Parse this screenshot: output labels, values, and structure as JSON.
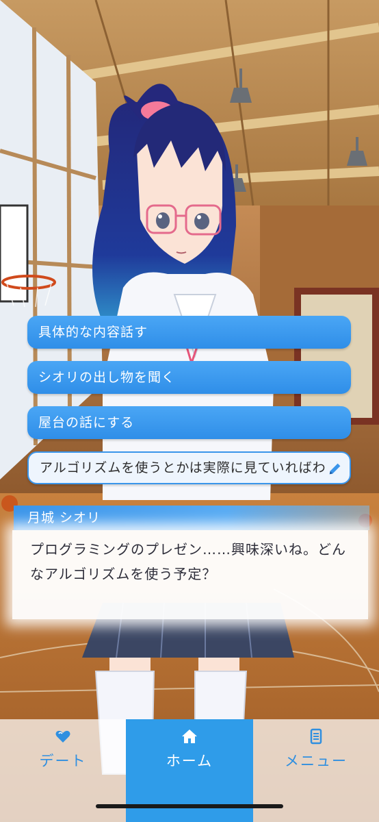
{
  "colors": {
    "accent": "#2f9ce9",
    "choice_bg": "#3a95ea",
    "tab_text": "#2f8fe0",
    "dialog_text": "#2e2e3a"
  },
  "choices": [
    {
      "label": "具体的な内容話す"
    },
    {
      "label": "シオリの出し物を聞く"
    },
    {
      "label": "屋台の話にする"
    }
  ],
  "free_input": {
    "value": "アルゴリズムを使うとかは実際に見ていればわ",
    "icon": "pencil-icon"
  },
  "dialogue": {
    "speaker": "月城 シオリ",
    "lines": [
      "プログラミングのプレゼン……興味深いね。どん",
      "なアルゴリズムを使う予定？"
    ]
  },
  "nav": {
    "date": {
      "label": "デート",
      "icon": "heart-icon"
    },
    "home": {
      "label": "ホーム",
      "icon": "home-icon"
    },
    "menu": {
      "label": "メニュー",
      "icon": "menu-list-icon"
    }
  }
}
